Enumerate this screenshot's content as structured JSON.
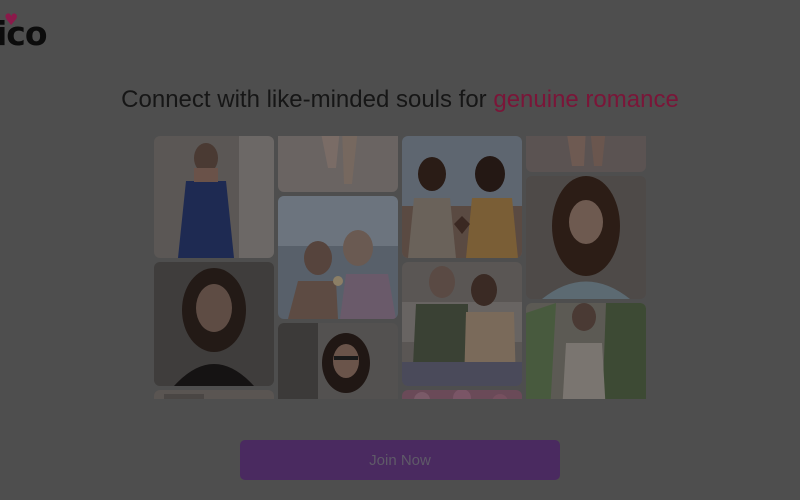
{
  "brand": {
    "logo_text": "ico"
  },
  "hero": {
    "headline_part1": "Connect with like-minded souls for ",
    "headline_accent": "genuine romance"
  },
  "gallery": {
    "photos": [
      {
        "id": "blue-dress-woman"
      },
      {
        "id": "brunette-portrait"
      },
      {
        "id": "partial-photo"
      },
      {
        "id": "legs-cropped"
      },
      {
        "id": "sparkler-couple"
      },
      {
        "id": "glasses-woman"
      },
      {
        "id": "heart-hands-couple"
      },
      {
        "id": "couch-couple"
      },
      {
        "id": "flowers-photo"
      },
      {
        "id": "cropped-top"
      },
      {
        "id": "long-hair-woman"
      },
      {
        "id": "palm-woman"
      }
    ]
  },
  "cta": {
    "join_label": "Join Now"
  },
  "colors": {
    "overlay": "#4e4e4e",
    "accent": "#7a1538",
    "button": "#4a2a60"
  }
}
